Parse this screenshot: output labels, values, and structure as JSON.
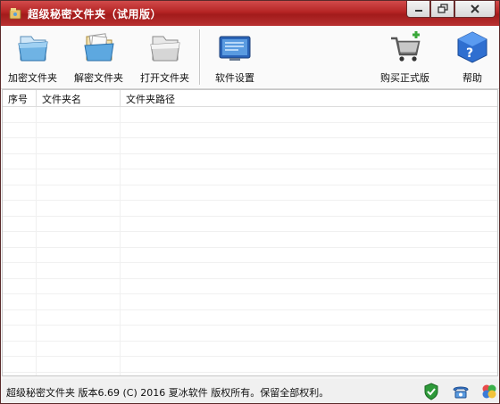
{
  "window": {
    "title": "超级秘密文件夹（试用版）"
  },
  "toolbar": {
    "encrypt": "加密文件夹",
    "decrypt": "解密文件夹",
    "open": "打开文件夹",
    "settings": "软件设置",
    "buy": "购买正式版",
    "help": "帮助"
  },
  "table": {
    "headers": [
      "序号",
      "文件夹名",
      "文件夹路径"
    ]
  },
  "status": {
    "text": "超级秘密文件夹 版本6.69 (C) 2016 夏冰软件 版权所有。保留全部权利。"
  },
  "colors": {
    "titlebar": "#b52424",
    "accent": "#2a8fd6"
  },
  "icons": [
    "app-icon",
    "minimize-icon",
    "restore-icon",
    "close-icon",
    "encrypt-folder-icon",
    "decrypt-folder-icon",
    "open-folder-icon",
    "settings-icon",
    "shopping-cart-icon",
    "help-icon",
    "shield-icon",
    "phone-icon",
    "clover-icon"
  ]
}
